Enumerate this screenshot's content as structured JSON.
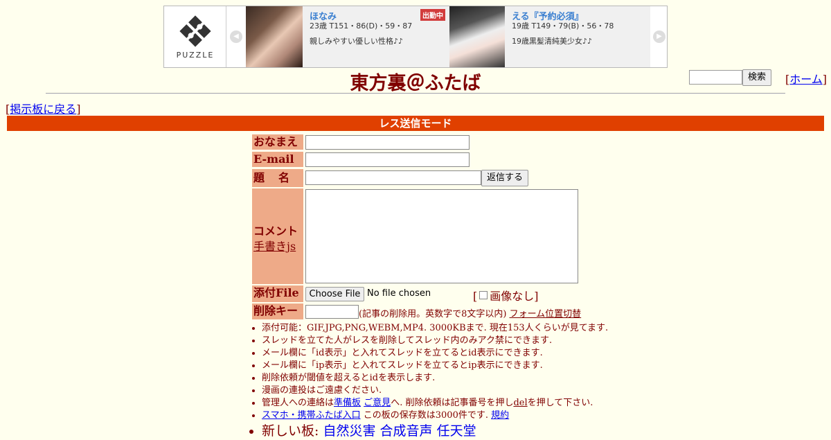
{
  "banner": {
    "logo_text": "PUZZLE",
    "cards": [
      {
        "name": "ほなみ",
        "stats": "23歳 T151・86(D)・59・87",
        "desc": "親しみやすい優しい性格♪♪",
        "badge": "出勤中"
      },
      {
        "name": "える『予約必須』",
        "stats": "19歳 T149・79(B)・56・78",
        "desc": "19歳黒髪清純美少女♪♪",
        "badge": ""
      }
    ]
  },
  "header": {
    "title": "東方裏＠ふたば",
    "search_button": "検索",
    "home_link": "ホーム",
    "back_link": "掲示板に戻る",
    "mode_bar": "レス送信モード"
  },
  "form": {
    "name_label": "おなまえ",
    "email_label": "E-mail",
    "subject_label": "題　名",
    "submit_button": "返信する",
    "comment_label": "コメント",
    "handwriting_link": "手書きjs",
    "file_label": "添付File",
    "choose_file_button": "Choose File",
    "no_file_text": "No file chosen",
    "no_image_label": "画像なし",
    "delkey_label": "削除キー",
    "delkey_note": "(記事の削除用。英数字で8文字以内)",
    "form_position_link": "フォーム位置切替"
  },
  "notes": {
    "items": [
      "添付可能：GIF,JPG,PNG,WEBM,MP4. 3000KBまで. 現在153人くらいが見てます.",
      "スレッドを立てた人がレスを削除してスレッド内のみアク禁にできます.",
      "メール欄に「id表示」と入れてスレッドを立てるとid表示にできます.",
      "メール欄に「ip表示」と入れてスレッドを立てるとip表示にできます.",
      "削除依頼が閾値を超えるとidを表示します.",
      "漫画の連投はご遠慮ください."
    ],
    "contact": {
      "prefix": "管理人への連絡は",
      "link1": "準備板",
      "link2": "ご意見",
      "middle": "へ. 削除依頼は記事番号を押し",
      "del_link": "del",
      "suffix": "を押して下さい."
    },
    "mobile": {
      "link": "スマホ・携帯ふたば入口",
      "text": " この板の保存数は3000件です. ",
      "rules_link": "規約"
    },
    "new_boards": {
      "prefix": "新しい板: ",
      "link1": "自然災害",
      "link2": "合成音声",
      "link3": "任天堂"
    }
  }
}
